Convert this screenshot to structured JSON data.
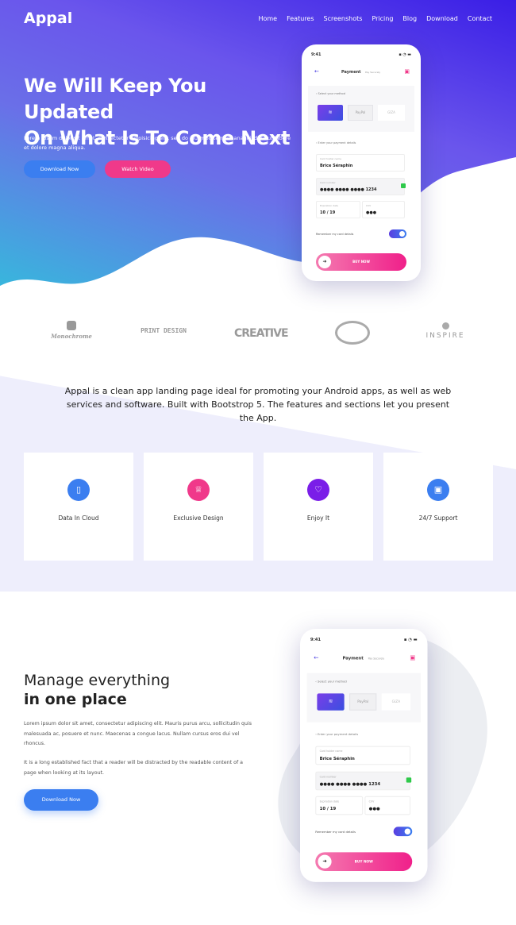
{
  "brand": "Appal",
  "nav": [
    "Home",
    "Features",
    "Screenshots",
    "Pricing",
    "Blog",
    "Download",
    "Contact"
  ],
  "hero": {
    "title_line1": "We Will Keep You Updated",
    "title_line2": "On What Is To Come Next",
    "text": "Lorem ipsum dolor sit amet, consectetur adipisicing elit, sed do eiusmod tempor anagi icdunt ut labore et dolore magna aliqua.",
    "download": "Download Now",
    "watch": "Watch Video"
  },
  "phone": {
    "time": "9:41",
    "title": "Payment",
    "subtitle": "Pay Securely",
    "select_method": "‹ Select your method",
    "paypal": "PayPal",
    "other": "GIZA",
    "enter_details": "‹ Enter your payment details",
    "name_label": "Card holder name",
    "name": "Brice Séraphin",
    "number_label": "Card number",
    "number": "●●●●   ●●●●   ●●●●   1234",
    "expiry_label": "Expiration date",
    "expiry": "10 / 19",
    "cvv_label": "CVV",
    "cvv": "●●●",
    "remember": "Remember my card details",
    "buy": "BUY NOW"
  },
  "logos": [
    "Monochrome",
    "PRINT DESIGN",
    "CREATIVE",
    "INSPIRE"
  ],
  "intro": "Appal is a clean app landing page ideal for promoting your Android apps, as well as web services and software. Built with Bootstrop 5. The features and sections let you present the App.",
  "features": [
    {
      "label": "Data In Cloud",
      "color": "#3b7ef0"
    },
    {
      "label": "Exclusive Design",
      "color": "#f0398a"
    },
    {
      "label": "Enjoy It",
      "color": "#7a1ee8"
    },
    {
      "label": "24/7 Support",
      "color": "#3b7ef0"
    }
  ],
  "section2": {
    "title_light": "Manage everything",
    "title_bold": "in one place",
    "p1": "Lorem ipsum dolor sit amet, consectetur adipiscing elit. Mauris purus arcu, sollicitudin quis malesuada ac, posuere et nunc. Maecenas a congue lacus. Nullam cursus eros dui vel rhoncus.",
    "p2": "It is a long established fact that a reader will be distracted by the readable content of a page when looking at its layout.",
    "download": "Download Now"
  }
}
